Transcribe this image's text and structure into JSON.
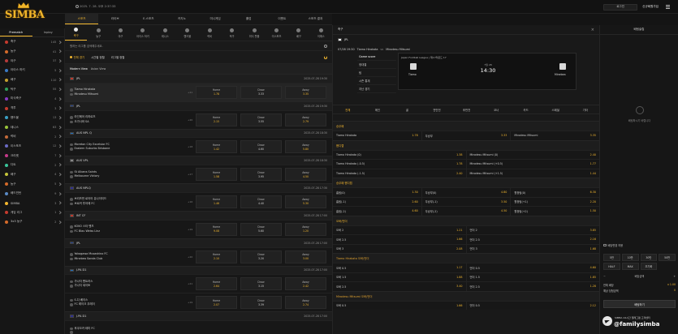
{
  "brand": {
    "logo_text": "SIMBA"
  },
  "header": {
    "datetime": "2025. 7. 28. 오후 2:37:33",
    "btn_1": "로그인",
    "user": "신규회원가입"
  },
  "nav": {
    "tabs": [
      "스포츠",
      "라이브",
      "E-스포츠",
      "카지노",
      "미니게임",
      "홀덤",
      "이벤트",
      "스포츠 결과"
    ],
    "active": 0
  },
  "sidebar": {
    "tabs": [
      "Prematch",
      "Inplay"
    ],
    "items": [
      {
        "name": "축구",
        "count": "145"
      },
      {
        "name": "농구",
        "count": "41"
      },
      {
        "name": "야구",
        "count": "37"
      },
      {
        "name": "아이스 하키",
        "count": "5"
      },
      {
        "name": "배구",
        "count": "110"
      },
      {
        "name": "탁구",
        "count": "55"
      },
      {
        "name": "미식축구",
        "count": "4"
      },
      {
        "name": "격투",
        "count": "3"
      },
      {
        "name": "핸드볼",
        "count": "13"
      },
      {
        "name": "테니스",
        "count": "63"
      },
      {
        "name": "럭비",
        "count": "2"
      },
      {
        "name": "이스포츠",
        "count": "12"
      },
      {
        "name": "크리켓",
        "count": "7"
      },
      {
        "name": "다트",
        "count": "2"
      },
      {
        "name": "배구",
        "count": "4"
      },
      {
        "name": "농구",
        "count": "5"
      },
      {
        "name": "배드민턴",
        "count": "9"
      },
      {
        "name": "SIMBA",
        "count": "3"
      },
      {
        "name": "게임 리그",
        "count": "1"
      },
      {
        "name": "3x3 농구",
        "count": "2"
      }
    ]
  },
  "sports_bar": [
    "축구",
    "농구",
    "야구",
    "아이스 하키",
    "테니스",
    "핸드볼",
    "럭비",
    "탁구",
    "미식 풋볼",
    "이스포츠",
    "배구",
    "이에스"
  ],
  "search": {
    "placeholder": "원하는 리그를 검색해주세요."
  },
  "filters": {
    "f1": "전체 경기",
    "f2": "시간별 정렬",
    "f3": "리그별 정렬"
  },
  "views": {
    "v1": "Modern View",
    "v2": "Asian View"
  },
  "odds_labels": {
    "home": "Home",
    "draw": "Draw",
    "away": "Away"
  },
  "matches": [
    {
      "league": "JPL",
      "time": "2025-07-28 19:30",
      "home": "Tiamo Hirakata",
      "away": "Mirodesu Mitsumi",
      "more": "+21",
      "odds": [
        "1.78",
        "3.33",
        "3.35"
      ],
      "selected": true
    },
    {
      "league": "JPL",
      "time": "2025-07-28 19:30",
      "home": "라인메어 리하르츠",
      "away": "오가사와 SA",
      "more": "+20",
      "odds": [
        "2.15",
        "3.55",
        "2.79"
      ]
    },
    {
      "league": "AUS NPL Q",
      "time": "2025-07-28 18:30",
      "home": "Moreton City Excelsior FC",
      "away": "Eastern Suburbs Brisbane",
      "more": "+18",
      "odds": [
        "1.42",
        "4.60",
        "5.80"
      ]
    },
    {
      "league": "AUS VPL",
      "time": "2025-07-28 18:30",
      "home": "St Albans Saints",
      "away": "Melbourne Victory",
      "more": "+17",
      "odds": [
        "1.58",
        "3.95",
        "4.50"
      ]
    },
    {
      "league": "AUS NPLQ",
      "time": "2025-07-28 17:30",
      "home": "브리즈번 로어어 유나이티드",
      "away": "브로커 투어에 FC",
      "more": "+16",
      "odds": [
        "1.46",
        "4.40",
        "5.30"
      ]
    },
    {
      "league": "INT CF",
      "time": "2025-07-28 17:00",
      "home": "KOKO 스타 멘츠",
      "away": "FC Blau Weiss Linz",
      "more": "+19",
      "odds": [
        "9.08",
        "5.60",
        "1.20"
      ]
    },
    {
      "league": "JPL",
      "time": "2025-07-28 17:00",
      "home": "Yokogawa Musashino FC",
      "away": "Minebea Sonda Club",
      "more": "+20",
      "odds": [
        "2.10",
        "3.20",
        "3.00"
      ]
    },
    {
      "league": "J.PA D1",
      "time": "2025-07-28 17:00",
      "home": "가나자 멘트러스",
      "away": "가나자 세이토",
      "more": "+21",
      "odds": [
        "2.64",
        "3.15",
        "2.42"
      ]
    },
    {
      "league": "",
      "time": "",
      "home": "S.다 베이스",
      "away": "FC 레이크 우레이",
      "more": "+19",
      "odds": [
        "2.07",
        "3.39",
        "2.74"
      ]
    },
    {
      "league": "J.PA D1",
      "time": "2025-07-28 17:00",
      "home": "후쿠오카 테미 FC",
      "away": "",
      "more": "",
      "odds": []
    }
  ],
  "detail": {
    "header": "축구",
    "league": "JPL",
    "date_time": "07/28 19:30",
    "home": "Tiamo Hirakata",
    "vs": "vs",
    "away": "Mirodesu Mitsumi",
    "menu": [
      "Game score",
      "정대결",
      "팀",
      "시즌 통계",
      "지난 경기"
    ],
    "board_league": "Japan Football League | 제17라운드 17",
    "board_date": "7월 28",
    "board_time": "14:30",
    "board_home": "Tiamo",
    "board_away": "Minebea",
    "market_tabs": [
      "전체",
      "메인",
      "골",
      "전반전",
      "후반전",
      "코너",
      "카드",
      "스페셜",
      "기타"
    ],
    "sections": [
      {
        "title": "승무패",
        "rows": [
          [
            [
              "Tiamo Hirakata",
              "1.78"
            ],
            [
              "무승부",
              "3.33"
            ],
            [
              "Mirodesu Mitsumi",
              "3.35"
            ]
          ]
        ]
      },
      {
        "title": "핸디캡",
        "rows": [
          [
            [
              "Tiamo Hirakata (0)",
              "1.38"
            ],
            [
              "Mirodesu Mitsumi (0)",
              "2.40"
            ]
          ],
          [
            [
              "Tiamo Hirakata (-0.5)",
              "1.78"
            ],
            [
              "Mirodesu Mitsumi (+0.5)",
              "1.77"
            ]
          ],
          [
            [
              "Tiamo Hirakata (-1.5)",
              "2.40"
            ],
            [
              "Mirodesu Mitsumi (+1.5)",
              "1.44"
            ]
          ]
        ]
      },
      {
        "title": "승무패 핸디캡",
        "rows": [
          [
            [
              "홈팀(0)",
              "1.30"
            ],
            [
              "무승부(0)",
              "4.80"
            ],
            [
              "원정팀(0)",
              "6.30"
            ]
          ],
          [
            [
              "홈팀(-1)",
              "2.60"
            ],
            [
              "무승부(-1)",
              "3.50"
            ],
            [
              "원정팀(+1)",
              "2.20"
            ]
          ],
          [
            [
              "홈팀(-2)",
              "4.60"
            ],
            [
              "무승부(-2)",
              "4.50"
            ],
            [
              "원정팀(+2)",
              "1.50"
            ]
          ]
        ]
      },
      {
        "title": "오버/언더",
        "rows": [
          [
            [
              "오버 2",
              "1.21"
            ],
            [
              "언더 2",
              "3.85"
            ]
          ],
          [
            [
              "오버 2.5",
              "1.66"
            ],
            [
              "언더 2.5",
              "2.16"
            ]
          ],
          [
            [
              "오버 3",
              "2.08"
            ],
            [
              "언더 3",
              "1.68"
            ]
          ]
        ]
      },
      {
        "title": "Tiamo Hirakata 오버/언더",
        "rows": [
          [
            [
              "오버 0.5",
              "1.17"
            ],
            [
              "언더 0.5",
              "4.60"
            ]
          ],
          [
            [
              "오버 1.5",
              "1.88"
            ],
            [
              "언더 1.5",
              "1.85"
            ]
          ],
          [
            [
              "오버 2.5",
              "3.40"
            ],
            [
              "언더 2.5",
              "1.28"
            ]
          ]
        ]
      },
      {
        "title": "Mirodesu Mitsumi 오버/언더",
        "rows": [
          [
            [
              "오버 0.5",
              "1.66"
            ],
            [
              "언더 0.5",
              "2.12"
            ]
          ]
        ]
      }
    ]
  },
  "betslip": {
    "title": "배팅슬립",
    "empty": "배팅하시기 바랍니다",
    "option": "배당변경 허용",
    "amounts": [
      "5만",
      "10만",
      "30만",
      "50만",
      "HALF",
      "MAX",
      "초기화"
    ],
    "stake_label": "배당금액",
    "total_odds_label": "전체 배당",
    "total_odds": "x 1.00",
    "est_win_label": "예상 당첨금액",
    "est_win": "0",
    "button": "배팅하기"
  },
  "promo": {
    "line1": "SIMBA 24시간 텔레그램 고객센터",
    "line2": "@familysimba"
  },
  "colors": {
    "accent": "#f4b82f",
    "bg": "#141414"
  }
}
